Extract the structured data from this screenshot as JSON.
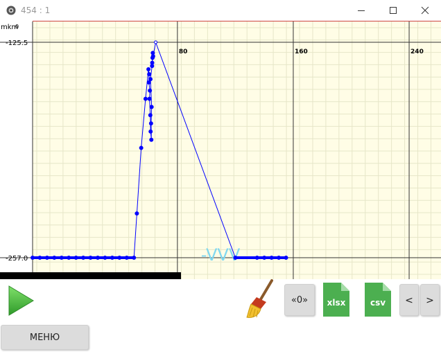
{
  "window": {
    "title": "454 : 1",
    "minimize_glyph": "–",
    "maximize_glyph": "□",
    "close_glyph": "×"
  },
  "chart_data": {
    "type": "line",
    "ylabel": "mkm",
    "xlim": [
      -20,
      262
    ],
    "ylim": [
      -257.0,
      -125.5
    ],
    "x_ticks": [
      80,
      160,
      240
    ],
    "x_tick_labels": [
      "80",
      "160",
      "240"
    ],
    "y_ticks": [
      -125.5,
      -257.0
    ],
    "y_tick_labels": [
      "-125.5",
      "-257.0"
    ],
    "annotation": "-VVV",
    "grid": true,
    "series": [
      {
        "color": "#0000ff",
        "x": [
          -20,
          -15,
          -10,
          -5,
          0,
          5,
          10,
          15,
          20,
          25,
          30,
          35,
          40,
          45,
          50,
          52,
          55,
          58,
          60,
          60.5,
          60.3,
          61,
          60.7,
          61.3,
          61.5,
          62,
          61.8,
          62.2,
          61.4,
          62.5,
          62.8,
          63,
          62.6,
          63.2,
          65,
          120,
          135,
          140,
          145,
          150,
          155
        ],
        "y": [
          -257,
          -257,
          -257,
          -257,
          -257,
          -257,
          -257,
          -257,
          -257,
          -257,
          -257,
          -257,
          -257,
          -257,
          -257,
          -230,
          -190,
          -160,
          -142,
          -145,
          -150,
          -155,
          -160,
          -170,
          -180,
          -185,
          -175,
          -165,
          -148,
          -140,
          -135,
          -132,
          -138,
          -134,
          -125.5,
          -257,
          -257,
          -257,
          -257,
          -257,
          -257
        ]
      }
    ]
  },
  "toolbar": {
    "play_icon": "play-icon",
    "broom_icon": "broom-icon",
    "zero_label": "«0»",
    "xlsx_label": "xlsx",
    "csv_label": "csv",
    "prev_label": "<",
    "next_label": ">",
    "menu_label": "МЕНЮ",
    "file_color": "#4caf50"
  }
}
